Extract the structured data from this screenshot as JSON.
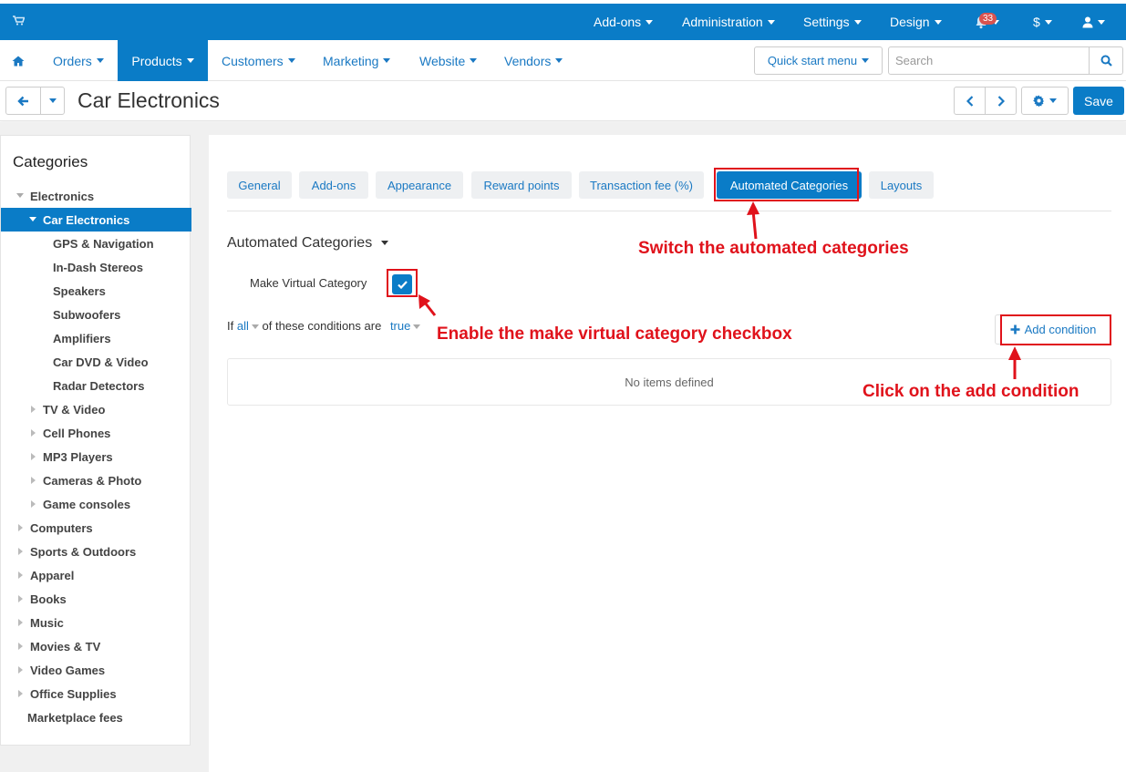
{
  "topbar": {
    "items": [
      {
        "label": "Add-ons"
      },
      {
        "label": "Administration"
      },
      {
        "label": "Settings"
      },
      {
        "label": "Design"
      }
    ],
    "notifications_count": "33",
    "currency": "$"
  },
  "nav": {
    "items": [
      {
        "label": "Orders"
      },
      {
        "label": "Products"
      },
      {
        "label": "Customers"
      },
      {
        "label": "Marketing"
      },
      {
        "label": "Website"
      },
      {
        "label": "Vendors"
      }
    ],
    "quick_start": "Quick start menu",
    "search_placeholder": "Search"
  },
  "header": {
    "title": "Car Electronics",
    "save_label": "Save"
  },
  "sidebar": {
    "title": "Categories",
    "items": [
      {
        "label": "Electronics"
      },
      {
        "label": "Car Electronics"
      },
      {
        "label": "GPS & Navigation"
      },
      {
        "label": "In-Dash Stereos"
      },
      {
        "label": "Speakers"
      },
      {
        "label": "Subwoofers"
      },
      {
        "label": "Amplifiers"
      },
      {
        "label": "Car DVD & Video"
      },
      {
        "label": "Radar Detectors"
      },
      {
        "label": "TV & Video"
      },
      {
        "label": "Cell Phones"
      },
      {
        "label": "MP3 Players"
      },
      {
        "label": "Cameras & Photo"
      },
      {
        "label": "Game consoles"
      },
      {
        "label": "Computers"
      },
      {
        "label": "Sports & Outdoors"
      },
      {
        "label": "Apparel"
      },
      {
        "label": "Books"
      },
      {
        "label": "Music"
      },
      {
        "label": "Movies & TV"
      },
      {
        "label": "Video Games"
      },
      {
        "label": "Office Supplies"
      },
      {
        "label": "Marketplace fees"
      }
    ]
  },
  "tabs": [
    {
      "label": "General"
    },
    {
      "label": "Add-ons"
    },
    {
      "label": "Appearance"
    },
    {
      "label": "Reward points"
    },
    {
      "label": "Transaction fee (%)"
    },
    {
      "label": "Automated Categories"
    },
    {
      "label": "Layouts"
    }
  ],
  "section": {
    "title": "Automated Categories",
    "virtual_label": "Make Virtual Category",
    "virtual_checked": true,
    "cond_if": "If",
    "cond_all": "all",
    "cond_mid": "of these conditions are",
    "cond_true": "true",
    "add_condition": "Add condition",
    "empty": "No items defined"
  },
  "annotations": {
    "a1": "Switch the automated categories",
    "a2": "Enable the make virtual category checkbox",
    "a3": "Click on the add condition"
  },
  "colors": {
    "primary": "#0a7cc7",
    "link": "#1a79c3",
    "annotation": "#e0121b"
  }
}
